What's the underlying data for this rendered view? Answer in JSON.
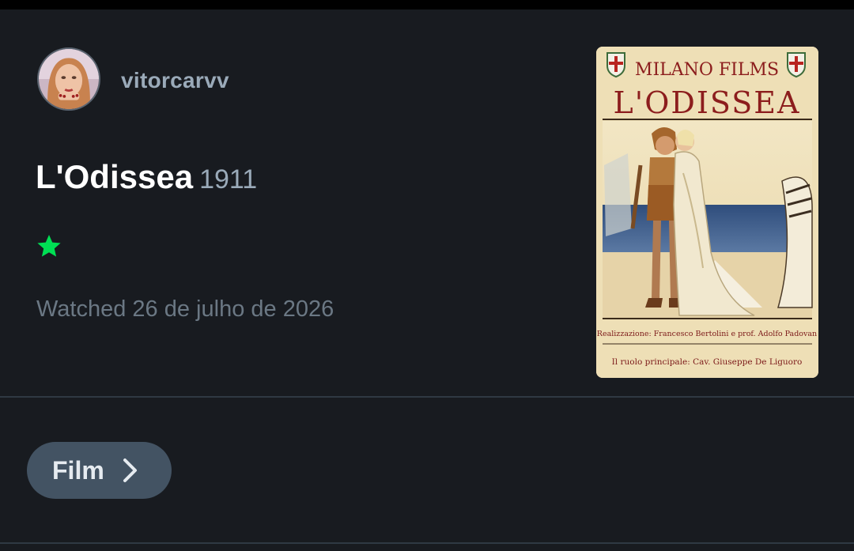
{
  "entry": {
    "username": "vitorcarvv",
    "title": "L'Odissea",
    "year": "1911",
    "rating_stars": 0.5,
    "watched_text": "Watched 26 de julho de 2026"
  },
  "poster": {
    "studio": "MILANO FILMS",
    "title": "L'ODISSEA",
    "credit_direction": "Realizzazione: Francesco Bertolini e prof. Adolfo Padovan",
    "credit_lead": "Il ruolo principale: Cav. Giuseppe De Liguoro"
  },
  "footer": {
    "type_button_label": "Film"
  },
  "colors": {
    "background": "#181b20",
    "star": "#00e054",
    "button_bg": "#435363"
  },
  "icons": {
    "rating": "star-icon",
    "navigate": "chevron-right-icon"
  }
}
